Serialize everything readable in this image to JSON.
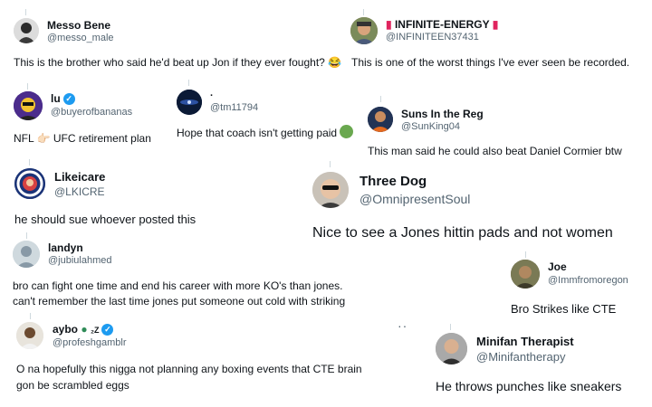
{
  "tweets": [
    {
      "name": "Messo Bene",
      "handle": "@messo_male",
      "text": "This is the brother who said he'd beat up Jon if they ever fought?",
      "emoji": "😂"
    },
    {
      "name": "INFINITE-ENERGY",
      "handle": "@INFINITEEN37431",
      "text": "This is one of the worst things I've ever seen be recorded."
    },
    {
      "name": "lu",
      "handle": "@buyerofbananas",
      "text": "NFL 👉🏻 UFC retirement plan"
    },
    {
      "name": "·",
      "handle": "@tm11794",
      "text": "Hope that coach isn't getting paid"
    },
    {
      "name": "Suns In the Reg",
      "handle": "@SunKing04",
      "text": "This man said he could also beat Daniel Cormier btw"
    },
    {
      "name": "Likeicare",
      "handle": "@LKICRE",
      "text": "he should sue whoever posted this"
    },
    {
      "name": "Three Dog",
      "handle": "@OmnipresentSoul",
      "text": "Nice to see a Jones hittin pads and not women"
    },
    {
      "name": "landyn",
      "handle": "@jubiulahmed",
      "text_line1": "bro can fight one time and end his career with more KO's than jones.",
      "text_line2": "can't remember the last time jones put someone out cold with striking"
    },
    {
      "name": "Joe",
      "handle": "@Immfromoregon",
      "text": "Bro Strikes like CTE"
    },
    {
      "name": "aybo",
      "name_suffix": "₂Z",
      "handle": "@profeshgamblr",
      "text_line1": "O na hopefully this nigga not planning any boxing events that CTE brain",
      "text_line2": "gon be scrambled eggs"
    },
    {
      "name": "Minifan Therapist",
      "handle": "@Minifantherapy",
      "text": "He throws punches like sneakers"
    }
  ],
  "more_icon": "··",
  "colors": {
    "verified": "#1d9bf0",
    "handle": "#536471",
    "text": "#0f1419",
    "fire": "#e0245e"
  }
}
